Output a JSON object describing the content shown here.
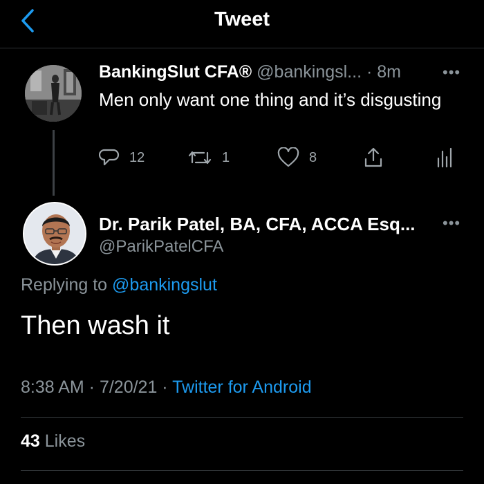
{
  "header": {
    "title": "Tweet"
  },
  "parent_tweet": {
    "name": "BankingSlut CFA®",
    "handle_time": "@bankingsl... · 8m",
    "text": "Men only want one thing and it’s disgusting",
    "replies": "12",
    "retweets": "1",
    "likes": "8"
  },
  "main_tweet": {
    "name": "Dr. Parik Patel, BA, CFA, ACCA Esq...",
    "handle": "@ParikPatelCFA",
    "replying_prefix": "Replying to",
    "replying_to": "@bankingslut",
    "text": "Then wash it",
    "time_date": "8:38 AM · 7/20/21 ·",
    "source": "Twitter for Android",
    "likes_count": "43",
    "likes_label": "Likes"
  },
  "colors": {
    "accent": "#1d9bf0",
    "muted": "#8b949a",
    "background": "#000000"
  },
  "icons": [
    "chevron-left-icon",
    "more-icon",
    "reply-icon",
    "retweet-icon",
    "heart-icon",
    "share-icon",
    "analytics-icon"
  ]
}
